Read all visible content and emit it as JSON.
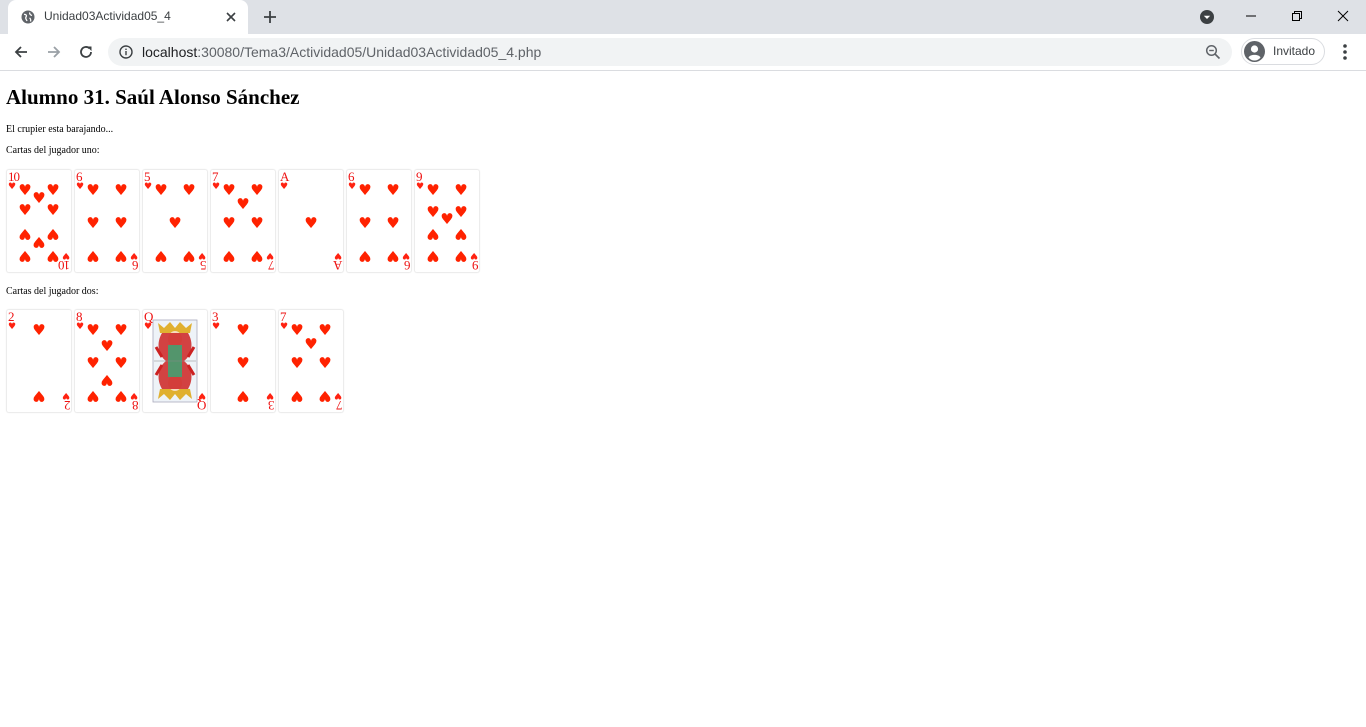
{
  "browser": {
    "tab_title": "Unidad03Actividad05_4",
    "url_host": "localhost",
    "url_path": ":30080/Tema3/Actividad05/Unidad03Actividad05_4.php",
    "profile_label": "Invitado"
  },
  "page": {
    "title": "Alumno 31. Saúl Alonso Sánchez",
    "shuffling_text": "El crupier esta barajando...",
    "player_one_label": "Cartas del jugador uno:",
    "player_two_label": "Cartas del jugador dos:",
    "suit_symbol": "♥",
    "suit_color": "#ff2200",
    "player_one_cards": [
      {
        "rank": "10",
        "suit": "hearts"
      },
      {
        "rank": "6",
        "suit": "hearts"
      },
      {
        "rank": "5",
        "suit": "hearts"
      },
      {
        "rank": "7",
        "suit": "hearts"
      },
      {
        "rank": "A",
        "suit": "hearts"
      },
      {
        "rank": "6",
        "suit": "hearts"
      },
      {
        "rank": "9",
        "suit": "hearts"
      }
    ],
    "player_two_cards": [
      {
        "rank": "2",
        "suit": "hearts"
      },
      {
        "rank": "8",
        "suit": "hearts"
      },
      {
        "rank": "Q",
        "suit": "hearts"
      },
      {
        "rank": "3",
        "suit": "hearts"
      },
      {
        "rank": "7",
        "suit": "hearts"
      }
    ]
  }
}
